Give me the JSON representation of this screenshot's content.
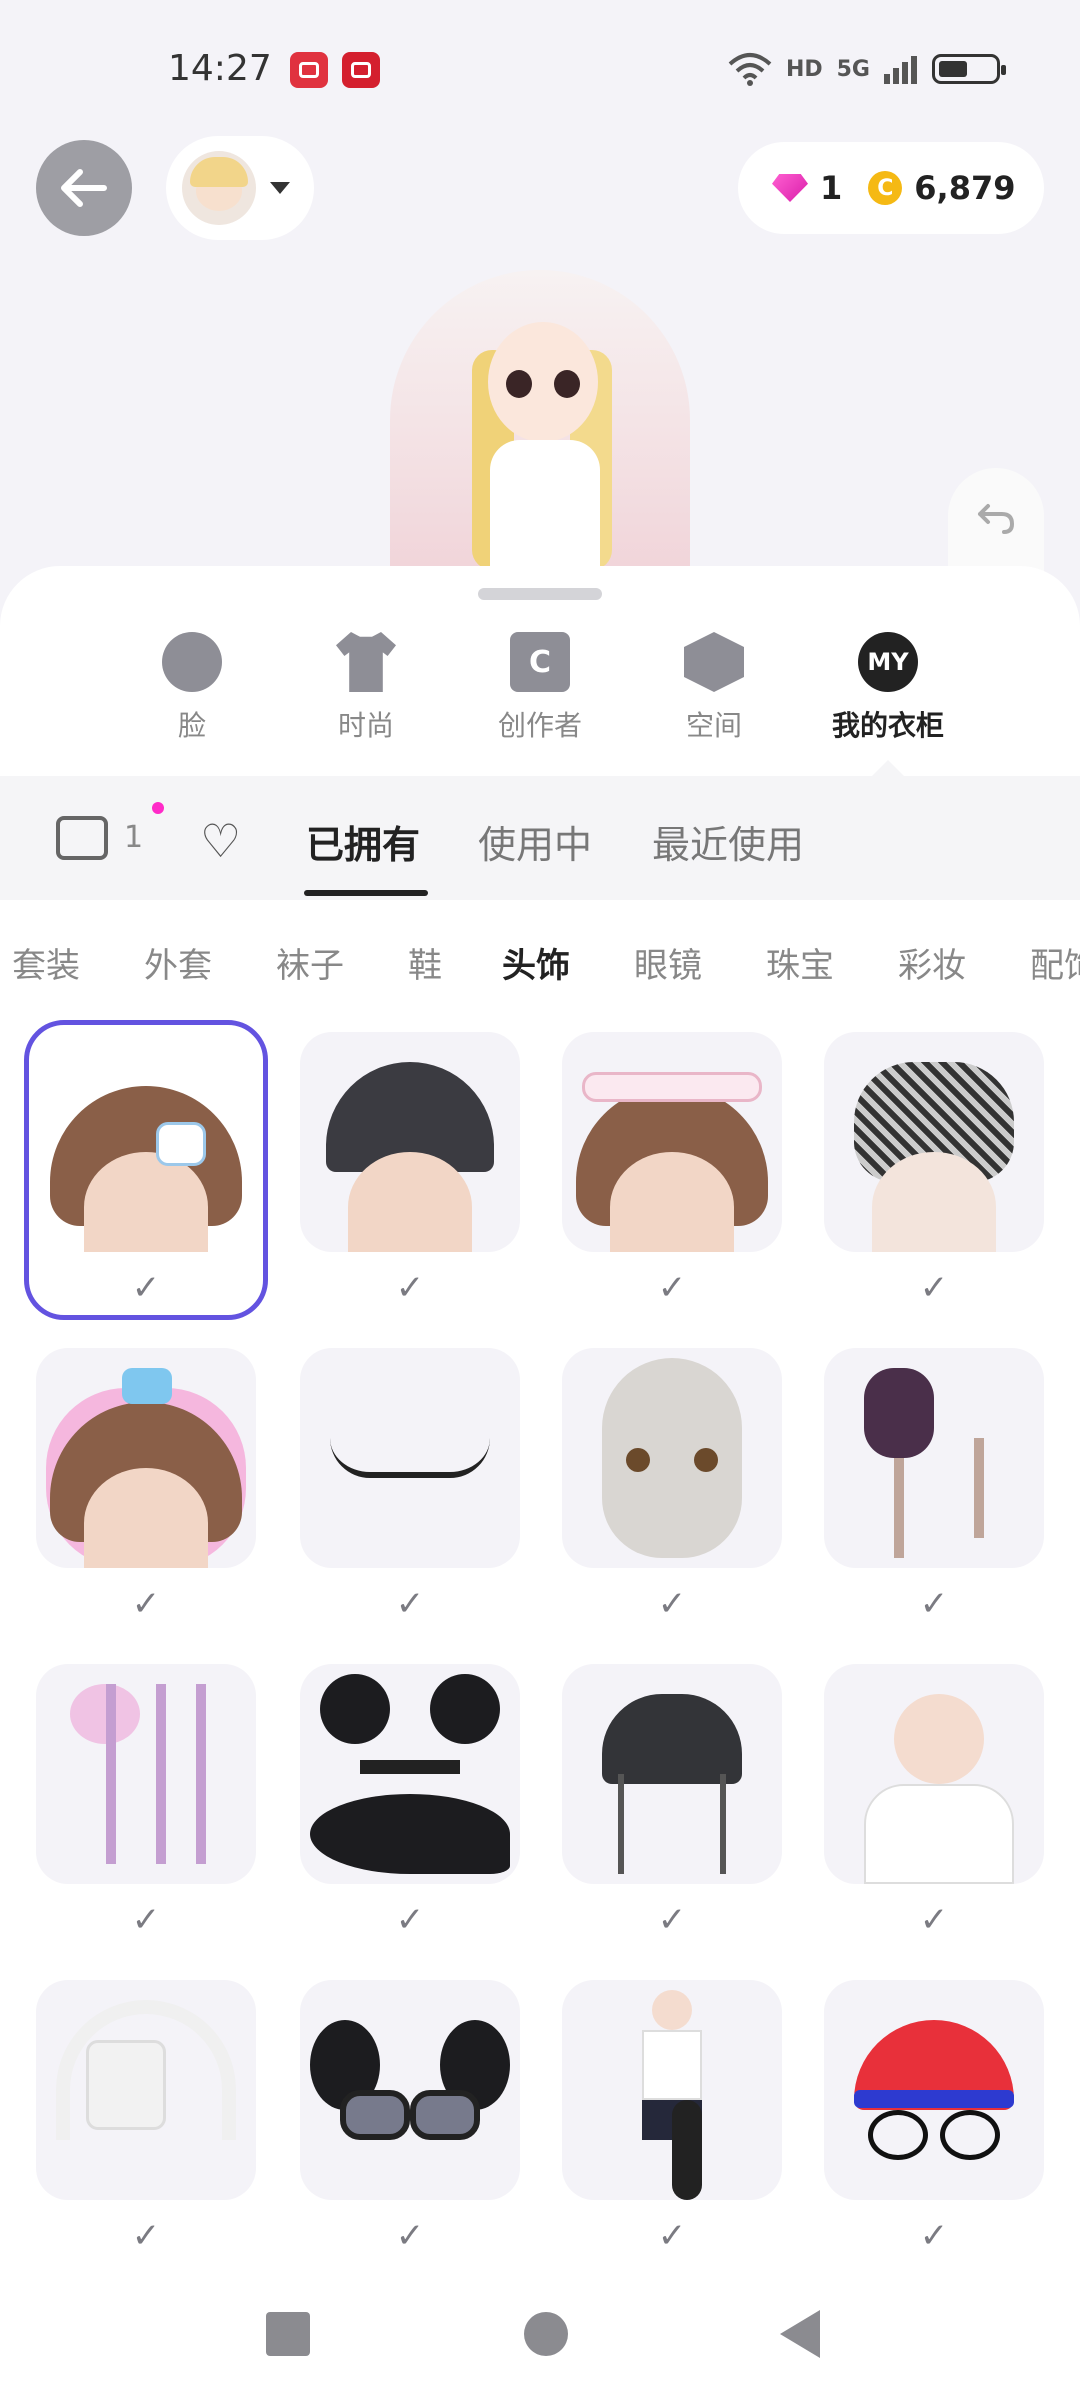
{
  "status_bar": {
    "time": "14:27",
    "hd": "HD",
    "network": "5G"
  },
  "header": {
    "gems": "1",
    "coins": "6,879",
    "coin_symbol": "C"
  },
  "category_tabs": [
    {
      "label": "脸",
      "icon": "face-icon"
    },
    {
      "label": "时尚",
      "icon": "shirt-icon"
    },
    {
      "label": "创作者",
      "icon": "creator-bag-icon",
      "glyph": "C"
    },
    {
      "label": "空间",
      "icon": "cube-icon"
    },
    {
      "label": "我的衣柜",
      "icon": "my-closet-icon",
      "glyph": "MY",
      "active": true
    }
  ],
  "closet": {
    "coupon_count": "1",
    "tabs": [
      {
        "label": "已拥有",
        "active": true
      },
      {
        "label": "使用中"
      },
      {
        "label": "最近使用"
      }
    ]
  },
  "item_types": [
    "套装",
    "外套",
    "袜子",
    "鞋",
    "头饰",
    "眼镜",
    "珠宝",
    "彩妆",
    "配饰"
  ],
  "active_item_type": "头饰",
  "items": [
    {
      "name": "bangs-hair-clip",
      "selected": true,
      "owned": true
    },
    {
      "name": "black-lace-veil",
      "owned": true
    },
    {
      "name": "pink-maid-headband",
      "owned": true
    },
    {
      "name": "black-fascinator-net",
      "owned": true
    },
    {
      "name": "bear-earmuffs",
      "owned": true
    },
    {
      "name": "eyelashes",
      "owned": true
    },
    {
      "name": "doll-head",
      "owned": true
    },
    {
      "name": "floral-hairpin-tassel",
      "owned": true
    },
    {
      "name": "pink-flower-hairpin",
      "owned": true
    },
    {
      "name": "black-fur-ears-tail",
      "owned": true
    },
    {
      "name": "cat-beanie-chains",
      "owned": true
    },
    {
      "name": "wink-avatar",
      "owned": true
    },
    {
      "name": "white-headphones",
      "owned": true
    },
    {
      "name": "fur-ears-goggles",
      "owned": true
    },
    {
      "name": "ears-and-tail-avatar",
      "owned": true
    },
    {
      "name": "red-cap-glasses",
      "owned": true
    }
  ],
  "colors": {
    "selected_border": "#6353e0",
    "gem": "#d91eaa",
    "coin": "#f5b914",
    "notification_dot": "#ff2bc8"
  }
}
